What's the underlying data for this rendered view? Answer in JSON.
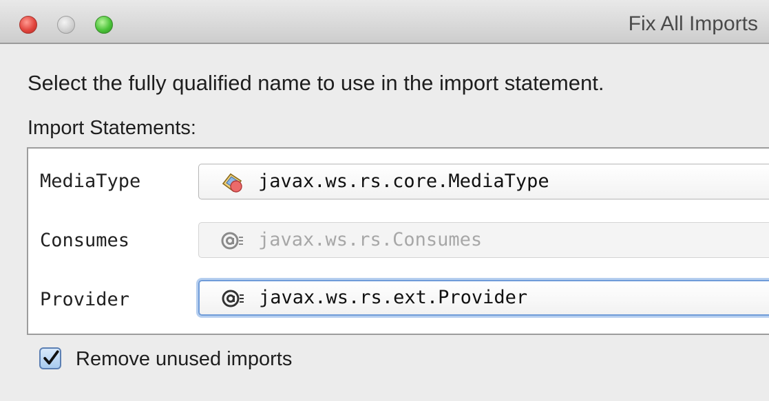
{
  "window": {
    "title": "Fix All Imports"
  },
  "dialog": {
    "instruction": "Select the fully qualified name to use in the import statement.",
    "section_label": "Import Statements:",
    "imports": [
      {
        "label": "MediaType",
        "value": "javax.ws.rs.core.MediaType",
        "icon": "class-icon",
        "state": "normal"
      },
      {
        "label": "Consumes",
        "value": "javax.ws.rs.Consumes",
        "icon": "annotation-icon",
        "state": "disabled"
      },
      {
        "label": "Provider",
        "value": "javax.ws.rs.ext.Provider",
        "icon": "annotation-icon",
        "state": "focused"
      }
    ],
    "remove_unused": {
      "label": "Remove unused imports",
      "checked": true
    }
  },
  "colors": {
    "focus_ring": "#6f9bd8",
    "checkbox_fill": "#a9cbef",
    "close_button": "#e2463f",
    "zoom_button": "#4cc43a"
  }
}
